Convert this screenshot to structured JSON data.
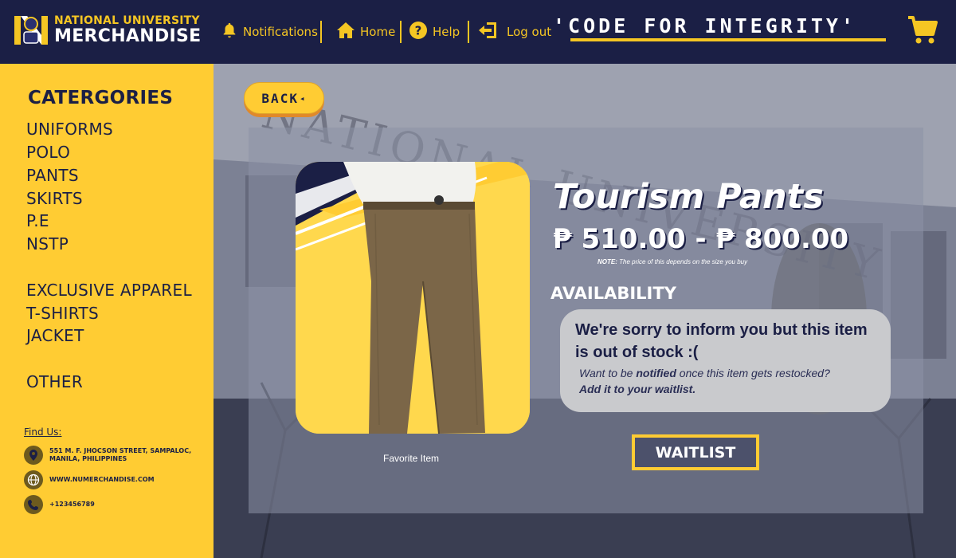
{
  "header": {
    "brand_line1": "NATIONAL UNIVERSITY",
    "brand_line2": "MERCHANDISE",
    "nav": {
      "notifications": "Notifications",
      "home": "Home",
      "help": "Help",
      "logout": "Log out"
    },
    "slogan": "'CODE FOR INTEGRITY'",
    "cart_icon": "shopping-cart-icon"
  },
  "sidebar": {
    "title": "CATERGORIES",
    "items": [
      "UNIFORMS",
      "POLO",
      "PANTS",
      "SKIRTS",
      "P.E",
      "NSTP"
    ],
    "items2": [
      "EXCLUSIVE APPAREL",
      "T-SHIRTS",
      "JACKET"
    ],
    "items3": [
      "OTHER"
    ],
    "find_us": "Find Us:",
    "address": "551 M. F. JHOCSON STREET, SAMPALOC, MANILA, PHILIPPINES",
    "website": "WWW.NUMERCHANDISE.COM",
    "phone": "+123456789"
  },
  "main": {
    "back_label": "BACK",
    "background_text": "NATIONAL UNIVERSITY",
    "product": {
      "name": "Tourism Pants",
      "price": "₱ 510.00 - ₱ 800.00",
      "note_label": "NOTE:",
      "note_text": "The price of this depends on the size you buy",
      "image_caption": "Favorite Item"
    },
    "availability_label": "AVAILABILITY",
    "stock_message": "We're sorry to inform you but this item is out of stock :(",
    "restock_prefix": "Want to be ",
    "restock_bold": "notified",
    "restock_suffix": " once this item gets restocked?",
    "waitlist_cta": "Add it to your waitlist.",
    "waitlist_button": "WAITLIST"
  },
  "colors": {
    "navy": "#1b1f45",
    "yellow": "#ffcc33",
    "orange_shadow": "#e0892a"
  }
}
